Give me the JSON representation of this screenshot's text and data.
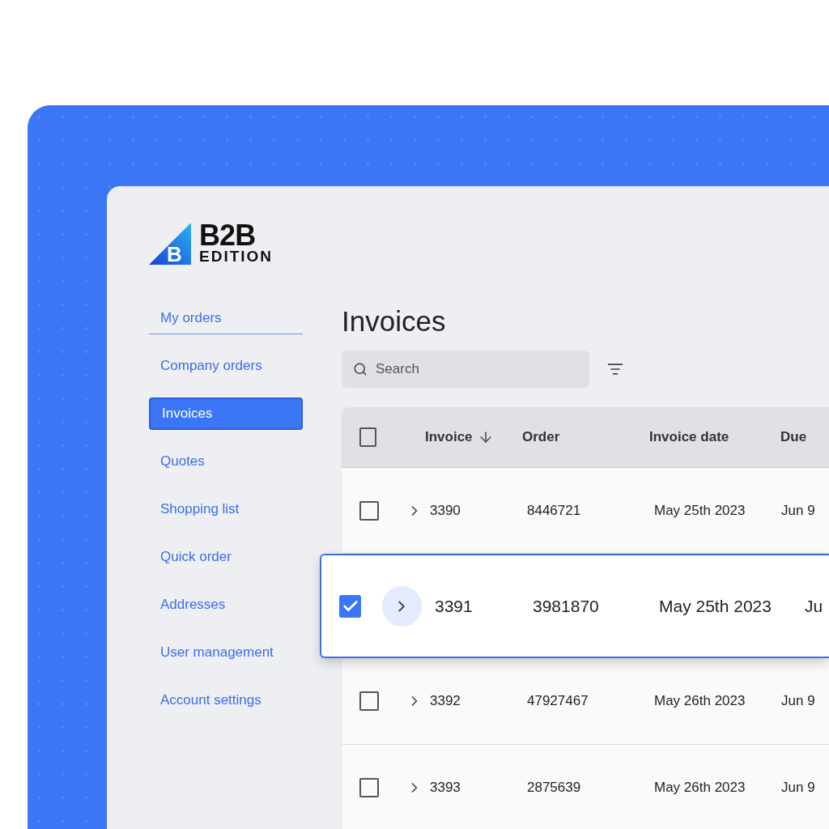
{
  "logo": {
    "mark": "B",
    "name": "B2B",
    "edition": "EDITION"
  },
  "sidebar": {
    "items": [
      {
        "label": "My orders",
        "selected": false,
        "focused": true
      },
      {
        "label": "Company orders",
        "selected": false,
        "focused": false
      },
      {
        "label": "Invoices",
        "selected": true,
        "focused": false
      },
      {
        "label": "Quotes",
        "selected": false,
        "focused": false
      },
      {
        "label": "Shopping list",
        "selected": false,
        "focused": false
      },
      {
        "label": "Quick order",
        "selected": false,
        "focused": false
      },
      {
        "label": "Addresses",
        "selected": false,
        "focused": false
      },
      {
        "label": "User management",
        "selected": false,
        "focused": false
      },
      {
        "label": "Account settings",
        "selected": false,
        "focused": false
      }
    ]
  },
  "page_title": "Invoices",
  "search": {
    "placeholder": "Search"
  },
  "table": {
    "header_checked": false,
    "columns": [
      {
        "label": "Invoice",
        "sorted": true
      },
      {
        "label": "Order"
      },
      {
        "label": "Invoice date"
      },
      {
        "label": "Due"
      }
    ],
    "rows": [
      {
        "checked": false,
        "selected": false,
        "cells": [
          "3390",
          "8446721",
          "May 25th 2023",
          "Jun 9"
        ]
      },
      {
        "checked": true,
        "selected": true,
        "cells": [
          "3391",
          "3981870",
          "May 25th 2023",
          "Ju"
        ]
      },
      {
        "checked": false,
        "selected": false,
        "cells": [
          "3392",
          "47927467",
          "May 26th 2023",
          "Jun 9"
        ]
      },
      {
        "checked": false,
        "selected": false,
        "cells": [
          "3393",
          "2875639",
          "May 26th 2023",
          "Jun 9"
        ]
      }
    ]
  }
}
